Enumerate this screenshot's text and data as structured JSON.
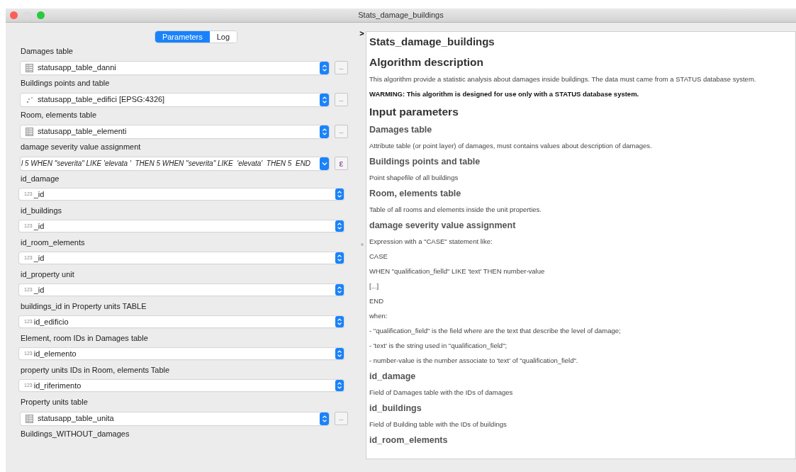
{
  "window": {
    "title": "Stats_damage_buildings"
  },
  "tabs": [
    {
      "label": "Parameters",
      "selected": true
    },
    {
      "label": "Log",
      "selected": false
    }
  ],
  "collapse_toggle": ">",
  "parameters": [
    {
      "label": "Damages table",
      "kind": "table_layer",
      "value": "statusapp_table_danni",
      "button": "..."
    },
    {
      "label": "Buildings points and table",
      "kind": "point_layer",
      "value": "statusapp_table_edifici [EPSG:4326]",
      "button": "..."
    },
    {
      "label": "Room, elements table",
      "kind": "table_layer",
      "value": "statusapp_table_elementi",
      "button": "..."
    },
    {
      "label": "damage severity value assignment",
      "kind": "expression",
      "value": "l 5 WHEN \"severita\" LIKE 'elevata '  THEN 5 WHEN \"severita\" LIKE  'elevata'  THEN 5  END",
      "button": "ε"
    },
    {
      "label": "id_damage",
      "kind": "field",
      "prefix": "123",
      "value": "_id"
    },
    {
      "label": "id_buildings",
      "kind": "field",
      "prefix": "123",
      "value": "_id"
    },
    {
      "label": "id_room_elements",
      "kind": "field",
      "prefix": "123",
      "value": "_id"
    },
    {
      "label": "id_property unit",
      "kind": "field",
      "prefix": "123",
      "value": "_id"
    },
    {
      "label": "buildings_id in Property units TABLE",
      "kind": "field",
      "prefix": "123",
      "value": "id_edificio"
    },
    {
      "label": "Element, room IDs in Damages table",
      "kind": "field",
      "prefix": "123",
      "value": "id_elemento"
    },
    {
      "label": "property units IDs in Room, elements Table",
      "kind": "field",
      "prefix": "123",
      "value": "id_riferimento"
    },
    {
      "label": "Property units table",
      "kind": "table_layer",
      "value": "statusapp_table_unita",
      "button": "..."
    },
    {
      "label": "Buildings_WITHOUT_damages",
      "kind": "label"
    }
  ],
  "help": [
    {
      "kind": "title",
      "text": "Stats_damage_buildings"
    },
    {
      "kind": "h1",
      "text": "Algorithm description"
    },
    {
      "kind": "p",
      "text": "This algorithm provide a statistic analysis about damages inside buildings. The data must came from a STATUS database system."
    },
    {
      "kind": "strong",
      "text": "WARMING: This algorithm is designed for use only with a STATUS database system."
    },
    {
      "kind": "h1",
      "text": "Input parameters"
    },
    {
      "kind": "h2",
      "text": "Damages table"
    },
    {
      "kind": "p",
      "text": "Attribute table (or point layer) of damages, must contains values about description of damages."
    },
    {
      "kind": "h2",
      "text": "Buildings points and table"
    },
    {
      "kind": "p",
      "text": "Point shapefile of all buildings"
    },
    {
      "kind": "h2",
      "text": "Room, elements table"
    },
    {
      "kind": "p",
      "text": "Table of all rooms and elements inside the unit properties."
    },
    {
      "kind": "h2",
      "text": "damage severity value assignment"
    },
    {
      "kind": "p",
      "text": "Expression with a \"CASE\" statement like:"
    },
    {
      "kind": "p",
      "text": "CASE"
    },
    {
      "kind": "p",
      "text": "WHEN \"qualification_fielld\" LIKE 'text' THEN number-value"
    },
    {
      "kind": "p",
      "text": "[...]"
    },
    {
      "kind": "p",
      "text": "END"
    },
    {
      "kind": "p",
      "text": "when:"
    },
    {
      "kind": "p",
      "text": "- \"qualification_field\" is the field where are the text that describe the level of damage;"
    },
    {
      "kind": "p",
      "text": "- 'text' is the string used in \"qualification_field\";"
    },
    {
      "kind": "p",
      "text": "- number-value is the number associate to 'text' of \"qualification_field\"."
    },
    {
      "kind": "h2",
      "text": "id_damage"
    },
    {
      "kind": "p",
      "text": "Field of Damages table with the IDs of damages"
    },
    {
      "kind": "h2",
      "text": "id_buildings"
    },
    {
      "kind": "p",
      "text": "Field of Building table with the IDs of buildings"
    },
    {
      "kind": "h2",
      "text": "id_room_elements"
    }
  ]
}
